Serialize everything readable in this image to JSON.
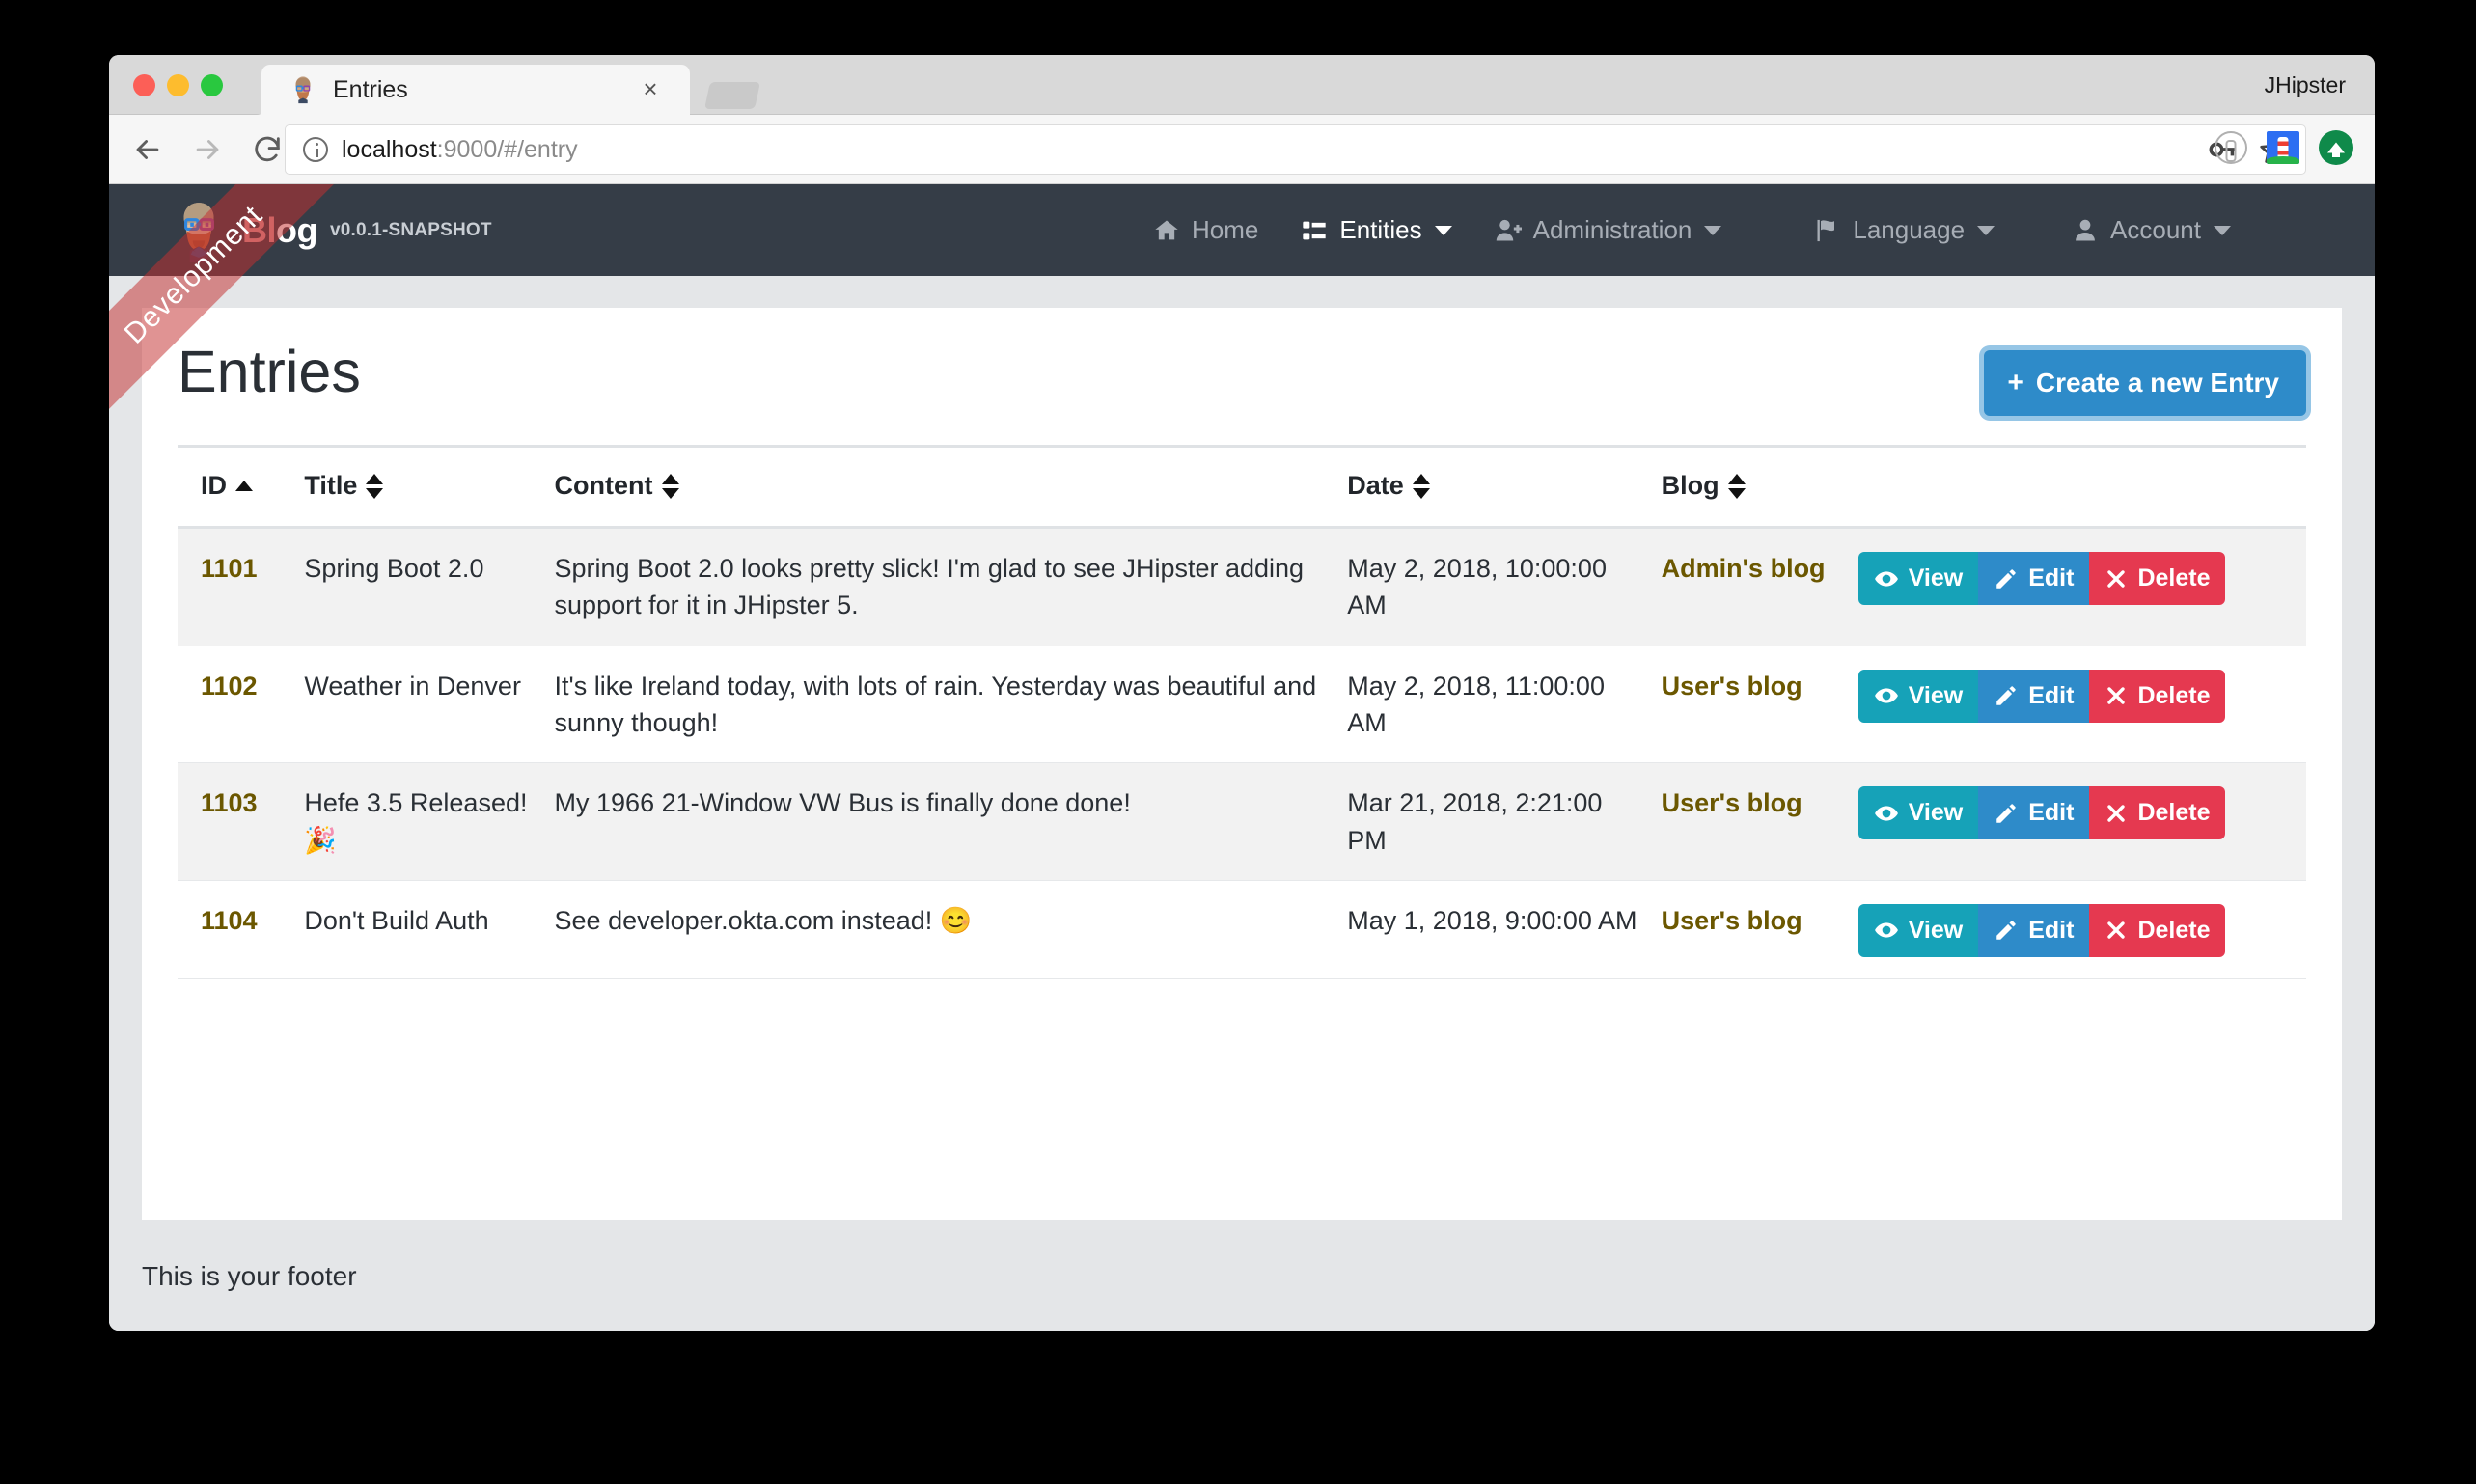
{
  "window": {
    "app_title": "JHipster",
    "tab_title": "Entries",
    "tab_close_label": "×",
    "url_host": "localhost",
    "url_path": ":9000/#/entry",
    "icons": {
      "back": "back-arrow-icon",
      "forward": "forward-arrow-icon",
      "reload": "reload-icon",
      "info": "site-info-icon",
      "key": "password-key-icon",
      "star": "bookmark-star-icon",
      "onepassword": "1password-icon",
      "lighthouse": "lighthouse-icon",
      "uploader": "green-upload-icon"
    }
  },
  "ribbon": {
    "label": "Development"
  },
  "navbar": {
    "brand_part1": "Bl",
    "brand_part2": "og",
    "version": "v0.0.1-SNAPSHOT",
    "links": [
      {
        "label": "Home",
        "icon": "home-icon",
        "has_caret": false,
        "active": false
      },
      {
        "label": "Entities",
        "icon": "list-icon",
        "has_caret": true,
        "active": true
      },
      {
        "label": "Administration",
        "icon": "user-plus-icon",
        "has_caret": true,
        "active": false
      },
      {
        "label": "Language",
        "icon": "flag-icon",
        "has_caret": true,
        "active": false
      },
      {
        "label": "Account",
        "icon": "user-icon",
        "has_caret": true,
        "active": false
      }
    ]
  },
  "page": {
    "title": "Entries",
    "create_button": "Create a new Entry",
    "create_button_plus": "+"
  },
  "table": {
    "headers": [
      {
        "label": "ID",
        "sort": "asc"
      },
      {
        "label": "Title",
        "sort": "both"
      },
      {
        "label": "Content",
        "sort": "both"
      },
      {
        "label": "Date",
        "sort": "both"
      },
      {
        "label": "Blog",
        "sort": "both"
      }
    ],
    "actions": {
      "view": "View",
      "edit": "Edit",
      "delete": "Delete",
      "view_icon": "eye-icon",
      "edit_icon": "pencil-icon",
      "delete_icon": "x-mark-icon"
    },
    "rows": [
      {
        "id": "1101",
        "title": "Spring Boot 2.0",
        "content": "Spring Boot 2.0 looks pretty slick! I'm glad to see JHipster adding support for it in JHipster 5.",
        "date": "May 2, 2018, 10:00:00 AM",
        "blog": "Admin's blog"
      },
      {
        "id": "1102",
        "title": "Weather in Denver",
        "content": "It's like Ireland today, with lots of rain. Yesterday was beautiful and sunny though!",
        "date": "May 2, 2018, 11:00:00 AM",
        "blog": "User's blog"
      },
      {
        "id": "1103",
        "title": "Hefe 3.5 Released! 🎉",
        "content": "My 1966 21-Window VW Bus is finally done done!",
        "date": "Mar 21, 2018, 2:21:00 PM",
        "blog": "User's blog"
      },
      {
        "id": "1104",
        "title": "Don't Build Auth",
        "content": "See developer.okta.com instead! 😊",
        "date": "May 1, 2018, 9:00:00 AM",
        "blog": "User's blog"
      }
    ]
  },
  "footer": {
    "text": "This is your footer"
  },
  "colors": {
    "navbar_bg": "#353d47",
    "primary": "#2e8bc9",
    "info": "#16a2b8",
    "danger": "#e53950",
    "link": "#6b5700",
    "ribbon": "#c43030"
  }
}
